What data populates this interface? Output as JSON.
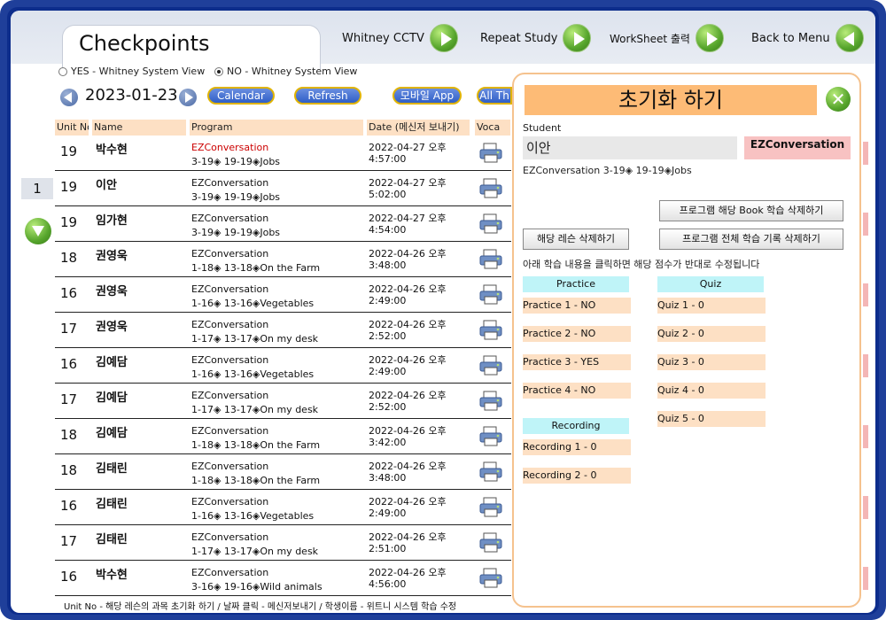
{
  "header": {
    "title": "Checkpoints",
    "nav": [
      {
        "label": "Whitney CCTV"
      },
      {
        "label": "Repeat Study"
      },
      {
        "label": "WorkSheet 출력"
      },
      {
        "label": "Back to Menu"
      }
    ]
  },
  "view_options": {
    "yes_label": "YES - Whitney System View",
    "no_label": "NO - Whitney System View",
    "selected": "NO"
  },
  "toolbar": {
    "date": "2023-01-23",
    "calendar": "Calendar",
    "refresh": "Refresh",
    "mobile_app": "모바일 App",
    "all": "All Th"
  },
  "table": {
    "headers": [
      "Unit No",
      "Name",
      "Program",
      "Date (메신저 보내기)",
      "Voca"
    ],
    "rows": [
      {
        "unit": "19",
        "name": "박수현",
        "program": "EZConversation",
        "lesson": "3-19◈ 19-19◈Jobs",
        "date": "2022-04-27 오후",
        "time": "4:57:00",
        "highlight": true
      },
      {
        "unit": "19",
        "name": "이안",
        "program": "EZConversation",
        "lesson": "3-19◈ 19-19◈Jobs",
        "date": "2022-04-27 오후",
        "time": "5:02:00",
        "highlight": false
      },
      {
        "unit": "19",
        "name": "임가현",
        "program": "EZConversation",
        "lesson": "3-19◈ 19-19◈Jobs",
        "date": "2022-04-27 오후",
        "time": "4:54:00",
        "highlight": false
      },
      {
        "unit": "18",
        "name": "권영욱",
        "program": "EZConversation",
        "lesson": "1-18◈ 13-18◈On the Farm",
        "date": "2022-04-26 오후",
        "time": "3:48:00",
        "highlight": false
      },
      {
        "unit": "16",
        "name": "권영욱",
        "program": "EZConversation",
        "lesson": "1-16◈ 13-16◈Vegetables",
        "date": "2022-04-26 오후",
        "time": "2:49:00",
        "highlight": false
      },
      {
        "unit": "17",
        "name": "권영욱",
        "program": "EZConversation",
        "lesson": "1-17◈ 13-17◈On my desk",
        "date": "2022-04-26 오후",
        "time": "2:52:00",
        "highlight": false
      },
      {
        "unit": "16",
        "name": "김예담",
        "program": "EZConversation",
        "lesson": "1-16◈ 13-16◈Vegetables",
        "date": "2022-04-26 오후",
        "time": "2:49:00",
        "highlight": false
      },
      {
        "unit": "17",
        "name": "김예담",
        "program": "EZConversation",
        "lesson": "1-17◈ 13-17◈On my desk",
        "date": "2022-04-26 오후",
        "time": "2:52:00",
        "highlight": false
      },
      {
        "unit": "18",
        "name": "김예담",
        "program": "EZConversation",
        "lesson": "1-18◈ 13-18◈On the Farm",
        "date": "2022-04-26 오후",
        "time": "3:42:00",
        "highlight": false
      },
      {
        "unit": "18",
        "name": "김태린",
        "program": "EZConversation",
        "lesson": "1-18◈ 13-18◈On the Farm",
        "date": "2022-04-26 오후",
        "time": "3:48:00",
        "highlight": false
      },
      {
        "unit": "16",
        "name": "김태린",
        "program": "EZConversation",
        "lesson": "1-16◈ 13-16◈Vegetables",
        "date": "2022-04-26 오후",
        "time": "2:49:00",
        "highlight": false
      },
      {
        "unit": "17",
        "name": "김태린",
        "program": "EZConversation",
        "lesson": "1-17◈ 13-17◈On my desk",
        "date": "2022-04-26 오후",
        "time": "2:51:00",
        "highlight": false
      },
      {
        "unit": "16",
        "name": "박수현",
        "program": "EZConversation",
        "lesson": "3-16◈ 19-16◈Wild animals",
        "date": "2022-04-26 오후",
        "time": "4:56:00",
        "highlight": false
      }
    ]
  },
  "pager": {
    "page": "1"
  },
  "footer": {
    "text": "Unit No - 해당 레슨의 과목 초기화 하기 / 날짜 클릭 - 메신저보내기 / 학생이름 - 위트니 시스템 학습 수정"
  },
  "modal": {
    "title": "초기화 하기",
    "student_label": "Student",
    "student_name": "이안",
    "program": "EZConversation",
    "lesson": "EZConversation 3-19◈ 19-19◈Jobs",
    "btn_delete_book": "프로그램 해당 Book 학습 삭제하기",
    "btn_delete_lesson": "해당 레슨 삭제하기",
    "btn_delete_all": "프로그램 전체 학습 기록 삭제하기",
    "instruction": "아래 학습 내용을 클릭하면 해당 점수가 반대로 수정됩니다",
    "practice_head": "Practice",
    "quiz_head": "Quiz",
    "recording_head": "Recording",
    "practice": [
      "Practice 1 - NO",
      "Practice 2 - NO",
      "Practice 3 - YES",
      "Practice 4 - NO"
    ],
    "quiz": [
      "Quiz 1 - 0",
      "Quiz 2 - 0",
      "Quiz 3 - 0",
      "Quiz 4 - 0",
      "Quiz 5 - 0"
    ],
    "recording": [
      "Recording 1 -  0",
      "Recording 2 -  0"
    ]
  },
  "colors": {
    "frame": "#0d2d8c",
    "header_cells": "#fde0c4",
    "modal_title": "#fdbb76",
    "program_badge": "#f8c2c2",
    "section_head": "#bff4f8",
    "highlight_text": "#cc0000"
  }
}
